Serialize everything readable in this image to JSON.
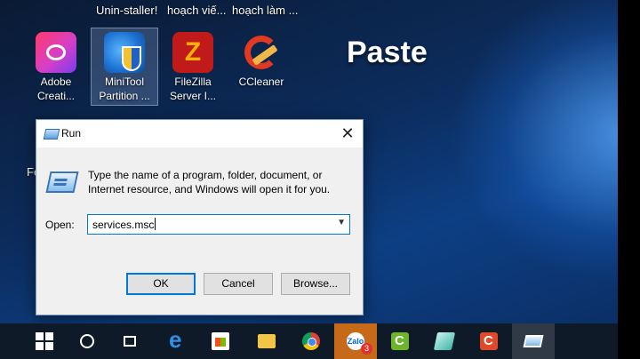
{
  "desktop": {
    "top_labels": [
      "Unin-staller!",
      "hoạch viế...",
      "hoạch làm ..."
    ],
    "icons": [
      {
        "name": "adobe-creative-cloud",
        "label": "Adobe Creati...",
        "selected": false
      },
      {
        "name": "minitool-partition",
        "label": "MiniTool Partition ...",
        "selected": true
      },
      {
        "name": "filezilla-server",
        "label": "FileZilla Server I...",
        "selected": false
      },
      {
        "name": "ccleaner",
        "label": "CCleaner",
        "selected": false
      }
    ],
    "overlay_text": "Paste",
    "partial_label": "Fo"
  },
  "run_dialog": {
    "title": "Run",
    "description": "Type the name of a program, folder, document, or Internet resource, and Windows will open it for you.",
    "open_label": "Open:",
    "open_value": "services.msc",
    "buttons": {
      "ok": "OK",
      "cancel": "Cancel",
      "browse": "Browse..."
    }
  },
  "taskbar": {
    "items": [
      "start",
      "cortana",
      "task-view",
      "edge",
      "store",
      "file-explorer",
      "chrome",
      "zalo",
      "camtasia",
      "glass-app",
      "ccleaner",
      "run"
    ],
    "zalo_badge": "3",
    "zalo_text": "Zalo"
  }
}
